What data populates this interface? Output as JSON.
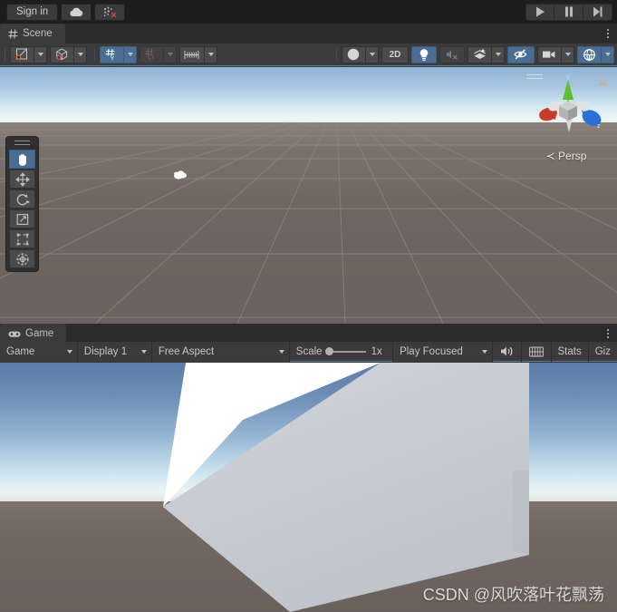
{
  "app": {
    "name": "Unity Editor",
    "theme_bg": "#383838",
    "accent_blue": "#4a6e93"
  },
  "topbar": {
    "signin_label": "Sign in",
    "cloud_icon": "cloud-icon",
    "services_icon": "services-bug-icon",
    "play_label": "play-icon",
    "pause_label": "pause-icon",
    "step_label": "step-icon"
  },
  "scene_panel": {
    "tab_label": "Scene",
    "tab_icon": "grid-hash-icon",
    "kebab": "panel-options-icon",
    "toolbar": {
      "pivot_label": "pivot-center-icon",
      "handle_label": "global-local-icon",
      "grid_snap_label": "grid-snapping-icon",
      "grid_snap_active": true,
      "snap_increment_label": "snap-increment-icon",
      "grid_size_label": "grid-size-icon",
      "draw_mode_label": "shading-mode-icon",
      "two_d_label": "2D",
      "lighting_label": "scene-lighting-icon",
      "audio_label": "scene-audio-mute-icon",
      "fx_label": "scene-effects-icon",
      "visibility_label": "scene-visibility-icon",
      "camera_label": "scene-camera-icon",
      "gizmos_label": "gizmos-icon"
    },
    "tool_palette": {
      "grip": "drag-handle",
      "tools": [
        {
          "name": "hand-tool",
          "icon": "hand-icon",
          "active": true
        },
        {
          "name": "move-tool",
          "icon": "move-arrows-icon",
          "active": false
        },
        {
          "name": "rotate-tool",
          "icon": "rotate-icon",
          "active": false
        },
        {
          "name": "scale-tool",
          "icon": "scale-icon",
          "active": false
        },
        {
          "name": "rect-tool",
          "icon": "rect-transform-icon",
          "active": false
        },
        {
          "name": "transform-tool",
          "icon": "transform-combined-icon",
          "active": false
        }
      ]
    },
    "gizmo": {
      "x_label": "x",
      "y_label": "y",
      "z_label": "z",
      "projection_label": "Persp",
      "projection_arrow": "≺",
      "lock_icon": "lock-open-icon",
      "x_color": "#c63c2a",
      "y_color": "#5fbf2a",
      "z_color": "#2a6fd6"
    },
    "viewport": {
      "sky_top_color": "#8fb4d6",
      "horizon_color": "#eef6f5",
      "ground_color": "#6f6560",
      "grid_line_color": "#8d847e",
      "cloud": "cloud-sprite"
    }
  },
  "game_panel": {
    "tab_label": "Game",
    "tab_icon": "gamepad-icon",
    "kebab": "panel-options-icon",
    "toolbar": {
      "view_selector": "Game",
      "display_selector": "Display 1",
      "aspect_selector": "Free Aspect",
      "scale_label": "Scale",
      "scale_value": "1x",
      "play_mode_selector": "Play Focused",
      "mute_icon": "audio-speaker-icon",
      "overlay_icon": "game-overlay-icon",
      "stats_label": "Stats",
      "gizmos_label": "Giz"
    },
    "viewport": {
      "sky_top_color": "#5b7ca8",
      "horizon_color": "#eaf5f3",
      "ground_color": "#6e645f",
      "cube_top_color": "#ffffff",
      "cube_front_color": "#c8cbd1",
      "cube_side_color": "#babec6"
    },
    "watermark": "CSDN @风吹落叶花飘荡"
  }
}
